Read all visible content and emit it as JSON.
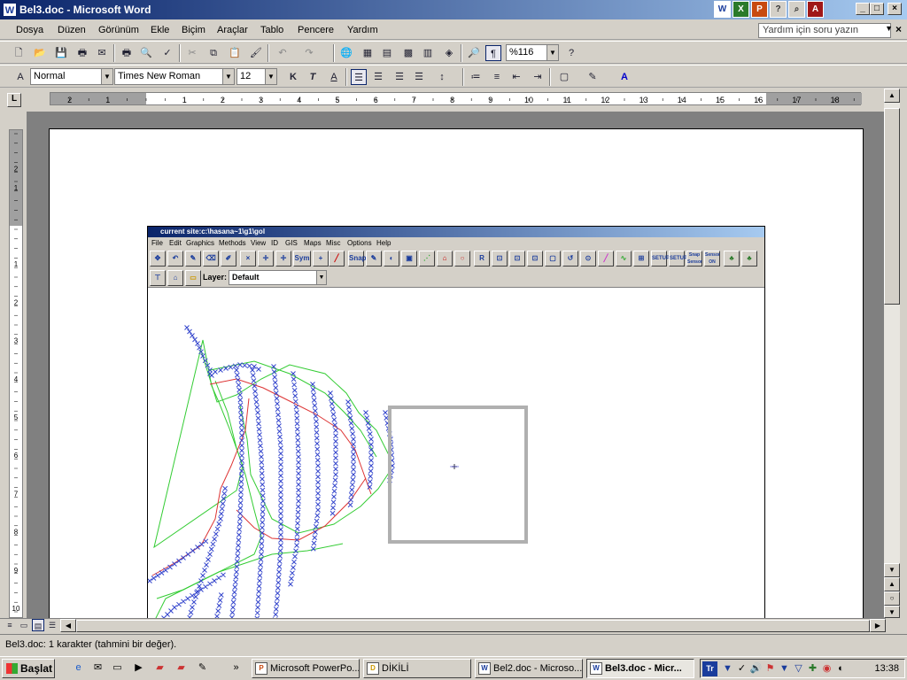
{
  "window": {
    "title": "Bel3.doc - Microsoft Word",
    "app_icon": "W"
  },
  "menubar": {
    "items": [
      "Dosya",
      "Düzen",
      "Görünüm",
      "Ekle",
      "Biçim",
      "Araçlar",
      "Tablo",
      "Pencere",
      "Yardım"
    ],
    "help_placeholder": "Yardım için soru yazın"
  },
  "toolbar_standard": {
    "zoom": "%116"
  },
  "toolbar_format": {
    "style": "Normal",
    "font": "Times New Roman",
    "size": "12",
    "bold": "K",
    "italic": "T",
    "underline": "A"
  },
  "ruler": {
    "labels": [
      "2",
      "1",
      "1",
      "2",
      "3",
      "4",
      "5",
      "6",
      "7",
      "8",
      "9",
      "10",
      "11",
      "12",
      "13",
      "14",
      "15",
      "16",
      "17",
      "18"
    ]
  },
  "vruler": {
    "labels": [
      "2",
      "1",
      "1",
      "2",
      "3",
      "4",
      "5",
      "6",
      "7",
      "8",
      "9",
      "10"
    ]
  },
  "embedded_app": {
    "title": "current site:c:\\hasana~1\\g1\\gol",
    "menu": [
      "File",
      "Edit",
      "Graphics",
      "Methods",
      "View",
      "ID",
      "GIS",
      "Maps",
      "Misc",
      "Options",
      "Help"
    ],
    "toolbar_labels": [
      "Sym",
      "Snap",
      "R",
      "SETUP",
      "SETUP",
      "Snap Sensor",
      "Sensor ON"
    ],
    "layer_label": "Layer:",
    "layer_value": "Default"
  },
  "statusbar": {
    "text": "Bel3.doc: 1 karakter (tahmini bir değer)."
  },
  "taskbar": {
    "start_label": "Başlat",
    "tasks": [
      {
        "label": "Microsoft PowerPo...",
        "icon": "P"
      },
      {
        "label": "DİKİLİ",
        "icon": "D"
      },
      {
        "label": "Bel2.doc - Microso...",
        "icon": "W"
      },
      {
        "label": "Bel3.doc - Micr...",
        "icon": "W",
        "active": true
      }
    ],
    "clock": "13:38"
  },
  "colors": {
    "titlebar": "#0a246a",
    "track_blue": "#3344cc",
    "line_green": "#33cc33",
    "line_red": "#dd3333",
    "selection_box": "#b0b0b0"
  }
}
